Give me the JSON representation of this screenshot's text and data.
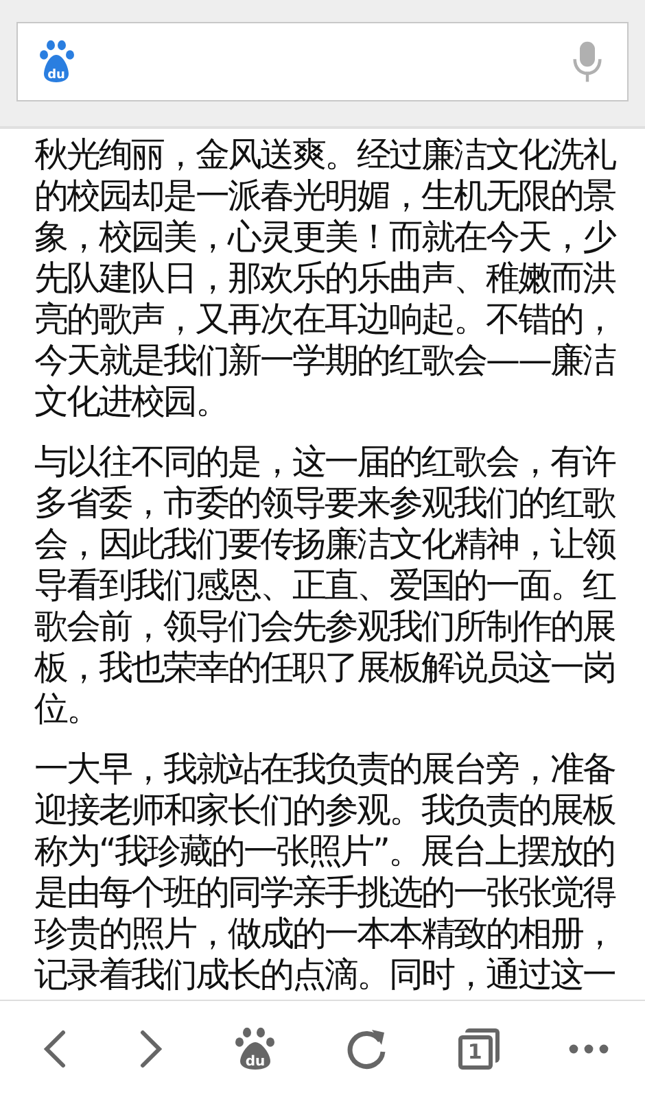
{
  "article": {
    "paragraphs": [
      "秋光绚丽，金风送爽。经过廉洁文化洗礼的校园却是一派春光明媚，生机无限的景象，校园美，心灵更美！而就在今天，少先队建队日，那欢乐的乐曲声、稚嫩而洪亮的歌声，又再次在耳边响起。不错的，今天就是我们新一学期的红歌会——廉洁文化进校园。",
      "与以往不同的是，这一届的红歌会，有许多省委，市委的领导要来参观我们的红歌会，因此我们要传扬廉洁文化精神，让领导看到我们感恩、正直、爱国的一面。红歌会前，领导们会先参观我们所制作的展板，我也荣幸的任职了展板解说员这一岗位。",
      "一大早，我就站在我负责的展台旁，准备迎接老师和家长们的参观。我负责的展板称为“我珍藏的一张照片”。展台上摆放的是由每个班的同学亲手挑选的一张张觉得珍贵的照片，做成的一本本精致的相册，记录着我们成长的点滴。同时，通过这一"
    ]
  },
  "search_bar": {
    "logo_text": "du"
  },
  "toolbar": {
    "logo_text": "du",
    "tab_count": "1"
  }
}
